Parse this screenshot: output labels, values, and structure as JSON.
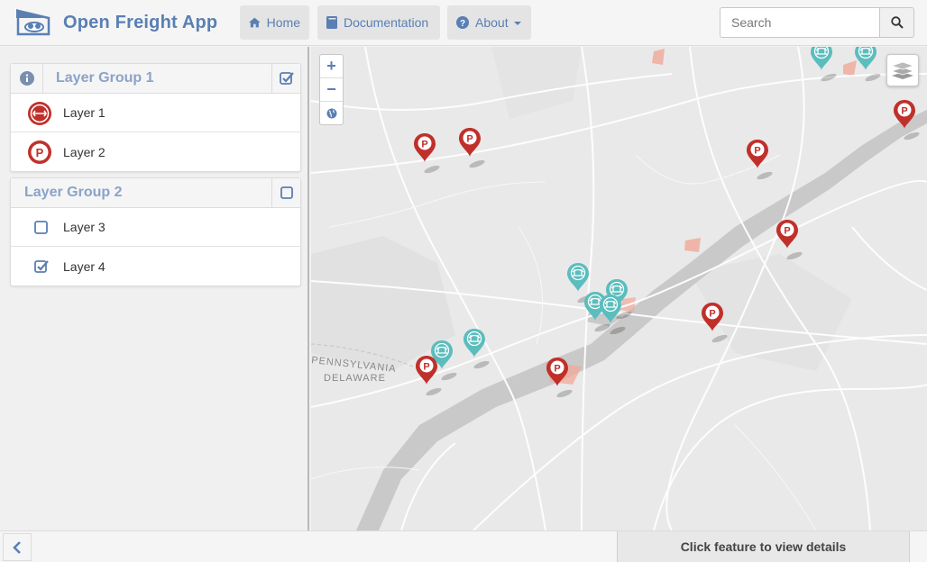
{
  "app": {
    "title": "Open Freight App"
  },
  "nav": {
    "home_label": "Home",
    "docs_label": "Documentation",
    "about_label": "About"
  },
  "search": {
    "placeholder": "Search",
    "value": ""
  },
  "sidebar": {
    "groups": [
      {
        "title": "Layer Group 1",
        "checked": true,
        "layers": [
          {
            "label": "Layer 1",
            "icon": "rail-crossing-marker-icon"
          },
          {
            "label": "Layer 2",
            "icon": "parking-marker-icon"
          }
        ]
      },
      {
        "title": "Layer Group 2",
        "checked": false,
        "layers": [
          {
            "label": "Layer 3",
            "checked": false
          },
          {
            "label": "Layer 4",
            "checked": true
          }
        ]
      }
    ]
  },
  "map": {
    "labels": [
      "PENNSYLVANIA",
      "DELAWARE"
    ],
    "zoom_in": "+",
    "zoom_out": "−"
  },
  "footer": {
    "status": "Click feature to view details"
  },
  "colors": {
    "accent": "#5a7fb3",
    "parking_marker": "#c0302b",
    "bridge_marker": "#5bbdbd",
    "water": "#c9c9c9",
    "urban": "#f0a898"
  }
}
